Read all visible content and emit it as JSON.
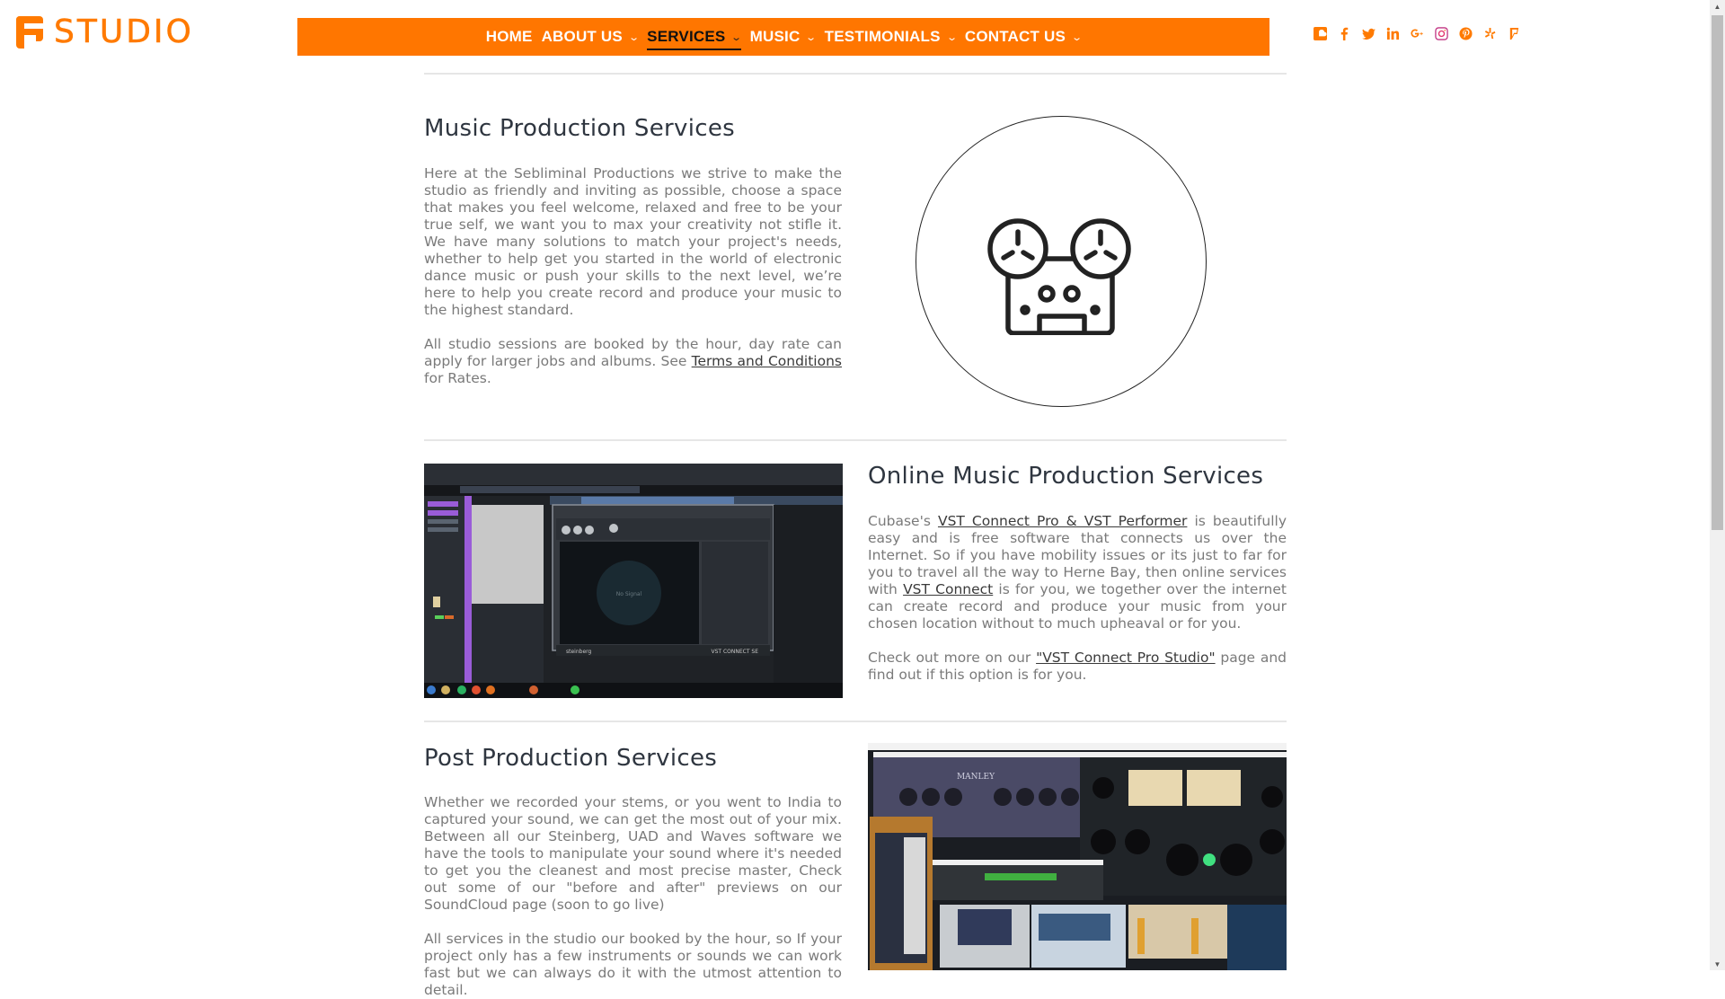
{
  "brand": {
    "logo_text": "STUDIO",
    "accent": "#ff7600"
  },
  "nav": {
    "items": [
      {
        "label": "HOME",
        "has_dropdown": false,
        "active": false
      },
      {
        "label": "ABOUT US",
        "has_dropdown": true,
        "active": false
      },
      {
        "label": "SERVICES",
        "has_dropdown": true,
        "active": true
      },
      {
        "label": "MUSIC",
        "has_dropdown": true,
        "active": false
      },
      {
        "label": "TESTIMONIALS",
        "has_dropdown": true,
        "active": false
      },
      {
        "label": "CONTACT US",
        "has_dropdown": true,
        "active": false
      }
    ],
    "chevron": "⌄"
  },
  "social": [
    "soundcloud-icon",
    "facebook-icon",
    "twitter-icon",
    "linkedin-icon",
    "google-plus-icon",
    "instagram-icon",
    "pinterest-icon",
    "yelp-icon",
    "foursquare-icon"
  ],
  "sections": {
    "music_production": {
      "title": "Music Production Services",
      "p1": "Here at the Sebliminal Productions we strive to make the studio as friendly and inviting as possible, choose a space that makes you feel welcome, relaxed and free to be your true self, we want you to max your creativity not stifle it. We have many solutions to match your project's needs, whether to help get you started in the world of electronic dance music or push your skills to the next level, we’re here to help you create record and produce your music to the highest standard.",
      "p2_before": "All studio sessions are booked by the hour, day rate can apply for larger jobs and albums. See ",
      "p2_link": "Terms and Conditions",
      "p2_after": " for Rates.",
      "image_icon": "reel-to-reel-tape-icon"
    },
    "online_production": {
      "title": "Online Music Production Services",
      "p1_a": "Cubase's ",
      "p1_link1": "VST Connect Pro & VST Performer",
      "p1_b": " is beautifully easy and is free software that connects us over the Internet. So if you have mobility issues or its just to far for you to travel all the way to Herne Bay, then online services with ",
      "p1_link2": "VST Connect",
      "p1_c": " is for you, we together over the internet can create record and produce your music from your chosen location without to much upheaval or for you.",
      "p2_a": "Check out more on our ",
      "p2_link": "\"VST Connect Pro Studio\"",
      "p2_b": " page and find out if this option is for you.",
      "screenshot_caption": "No Signal",
      "screenshot_brand": "steinberg",
      "screenshot_product": "VST CONNECT SE"
    },
    "post_production": {
      "title": "Post Production Services",
      "p1": "Whether we recorded your stems, or you went to India to captured your sound, we can get the most out of your mix. Between all our Steinberg, UAD and Waves software we have the tools to manipulate your sound where it's needed to get you the cleanest and most precise master, Check out some of our \"before and after\" previews  on our SoundCloud page (soon to go live)",
      "p2": "All services in the studio our booked by the hour, so If your project only has a few instruments or sounds we can work fast but we can always do it with the utmost attention to detail.",
      "screenshot_label": "MANLEY"
    }
  }
}
